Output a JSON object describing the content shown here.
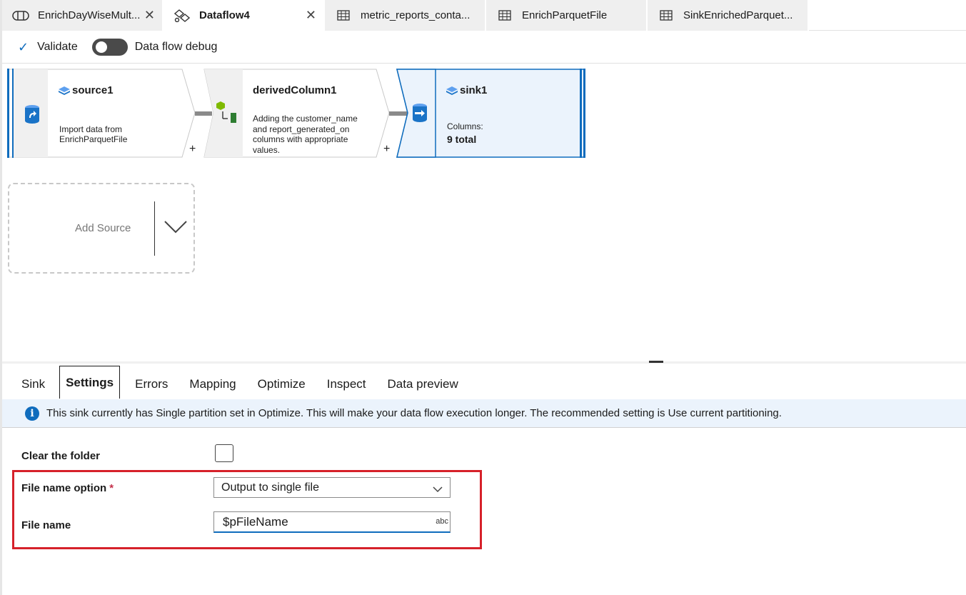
{
  "tabs": [
    {
      "label": "EnrichDayWiseMult...",
      "icon": "pipeline-icon",
      "closable": true,
      "active": false
    },
    {
      "label": "Dataflow4",
      "icon": "dataflow-icon",
      "closable": true,
      "active": true
    },
    {
      "label": "metric_reports_conta...",
      "icon": "table-icon",
      "closable": false,
      "active": false
    },
    {
      "label": "EnrichParquetFile",
      "icon": "table-icon",
      "closable": false,
      "active": false
    },
    {
      "label": "SinkEnrichedParquet...",
      "icon": "table-icon",
      "closable": false,
      "active": false
    }
  ],
  "toolbar": {
    "validate_label": "Validate",
    "debug_label": "Data flow debug",
    "debug_on": false
  },
  "nodes": {
    "source": {
      "title": "source1",
      "desc1": "Import data from",
      "desc2": "EnrichParquetFile"
    },
    "derived": {
      "title": "derivedColumn1",
      "desc1": "Adding the customer_name",
      "desc2": "and report_generated_on",
      "desc3": "columns with appropriate",
      "desc4": "values."
    },
    "sink": {
      "title": "sink1",
      "columns_label": "Columns:",
      "columns_value": "9 total"
    }
  },
  "add_source": {
    "label": "Add Source"
  },
  "panel_tabs": [
    "Sink",
    "Settings",
    "Errors",
    "Mapping",
    "Optimize",
    "Inspect",
    "Data preview"
  ],
  "active_panel_tab": "Settings",
  "info_message": "This sink currently has Single partition set in Optimize. This will make your data flow execution longer. The recommended setting is Use current partitioning.",
  "settings": {
    "clear_folder_label": "Clear the folder",
    "clear_folder_checked": false,
    "file_name_option_label": "File name option",
    "required_marker": "*",
    "file_name_option_value": "Output to single file",
    "file_name_label": "File name",
    "file_name_value": "$pFileName",
    "file_name_type_badge": "abc"
  },
  "colors": {
    "accent": "#0f6cbd",
    "highlight": "#d6212a"
  }
}
